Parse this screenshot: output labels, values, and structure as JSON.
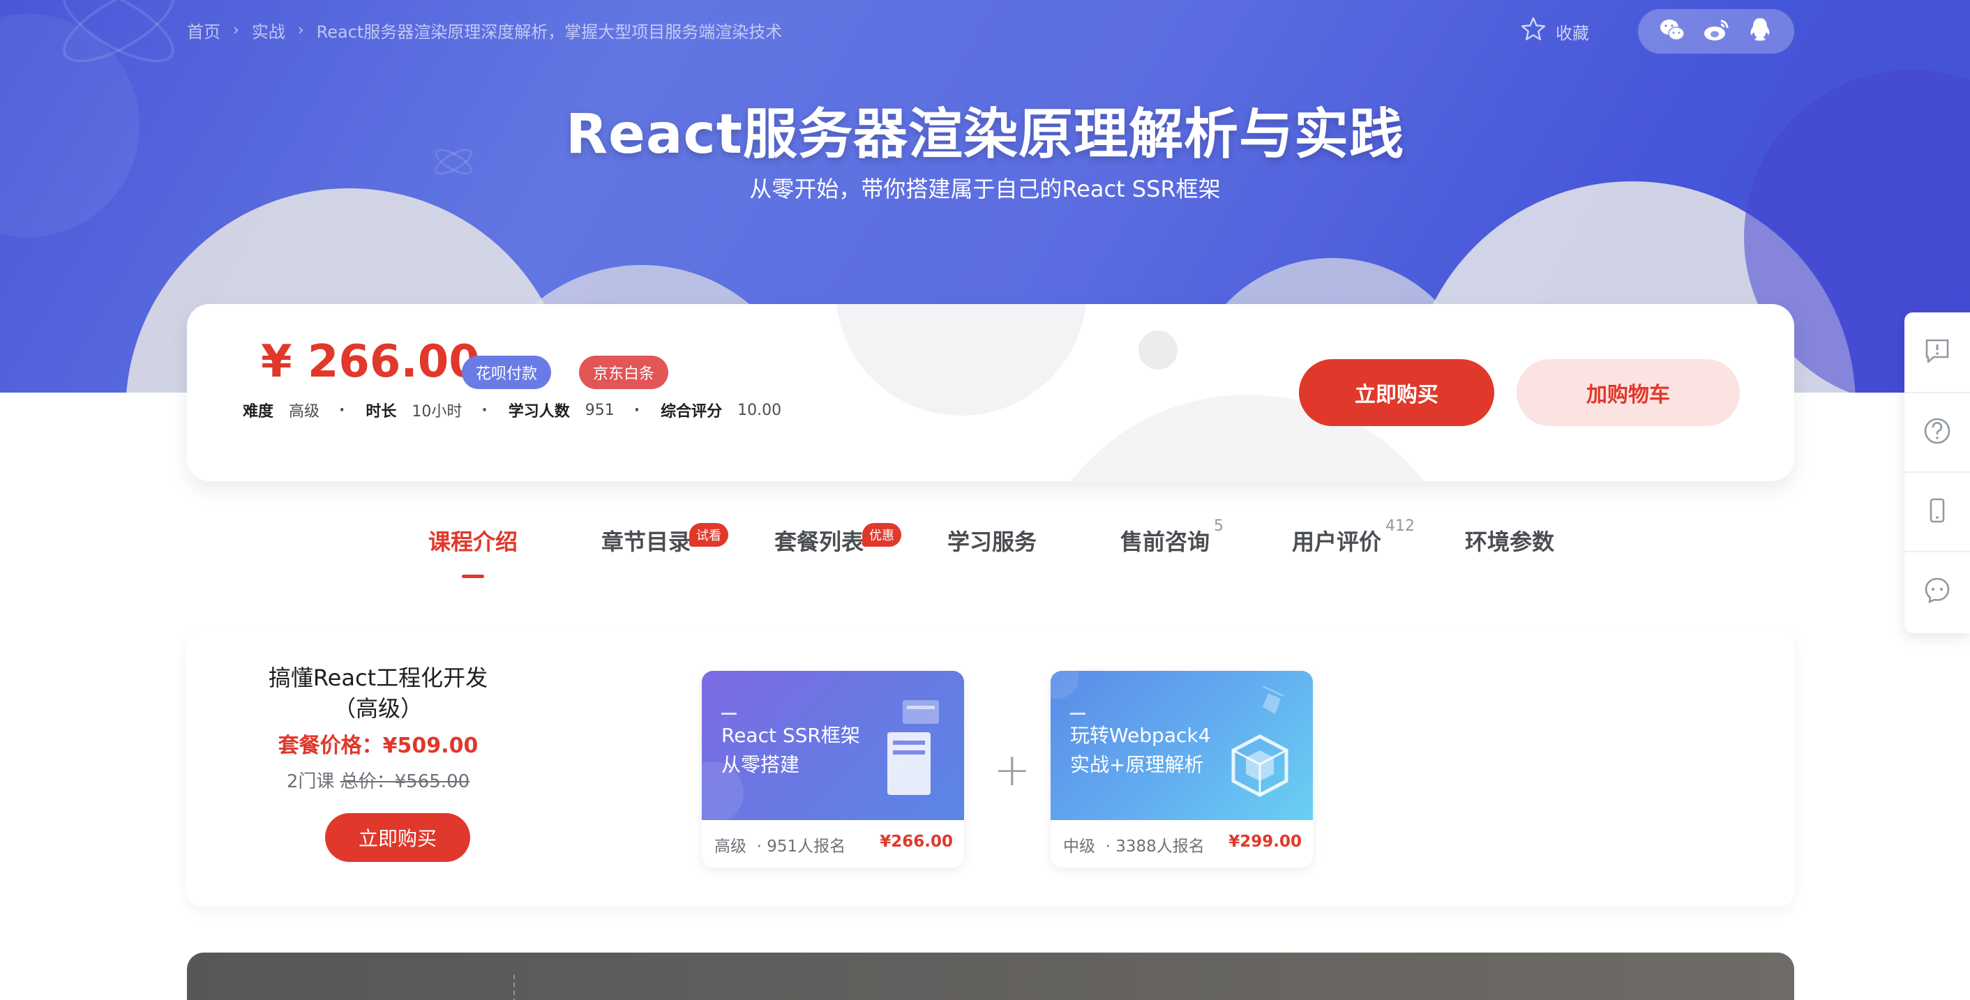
{
  "breadcrumb": {
    "home": "首页",
    "category": "实战",
    "current": "React服务器渲染原理深度解析，掌握大型项目服务端渲染技术",
    "separator": "›"
  },
  "header": {
    "favorite_label": "收藏",
    "favorite_icon": "star-icon",
    "share_icons": [
      "wechat-icon",
      "weibo-icon",
      "qq-icon"
    ]
  },
  "course": {
    "title": "React服务器渲染原理解析与实践",
    "subtitle": "从零开始，带你搭建属于自己的React SSR框架",
    "price": "¥ 266.00",
    "pay_tags": [
      "花呗付款",
      "京东白条"
    ],
    "stats": {
      "difficulty_label": "难度",
      "difficulty": "高级",
      "duration_label": "时长",
      "duration": "10小时",
      "students_label": "学习人数",
      "students": "951",
      "score_label": "综合评分",
      "score": "10.00",
      "dot": "·"
    },
    "buy_label": "立即购买",
    "cart_label": "加购物车"
  },
  "tabs": [
    {
      "label": "课程介绍",
      "active": true
    },
    {
      "label": "章节目录",
      "badge": "试看"
    },
    {
      "label": "套餐列表",
      "badge": "优惠"
    },
    {
      "label": "学习服务"
    },
    {
      "label": "售前咨询",
      "count": "5"
    },
    {
      "label": "用户评价",
      "count": "412"
    },
    {
      "label": "环境参数"
    }
  ],
  "package": {
    "name": "搞懂React工程化开发（高级）",
    "price": "套餐价格：¥509.00",
    "count": "2门课",
    "total": "总价：¥565.00",
    "buy_label": "立即购买",
    "plus": "+",
    "courses": [
      {
        "cover_line1": "React SSR框架",
        "cover_line2": "从零搭建",
        "level": "高级",
        "enrolled": "· 951人报名",
        "price": "¥266.00"
      },
      {
        "cover_line1": "玩转Webpack4",
        "cover_line2": "实战+原理解析",
        "level": "中级",
        "enrolled": "· 3388人报名",
        "price": "¥299.00"
      }
    ]
  },
  "sidebar": {
    "icons": [
      "feedback-icon",
      "help-icon",
      "mobile-icon",
      "chat-icon"
    ]
  },
  "colors": {
    "accent": "#e0382b",
    "hero": "#5b6de0",
    "huabei": "#6b7be5",
    "jd": "#e25656"
  }
}
